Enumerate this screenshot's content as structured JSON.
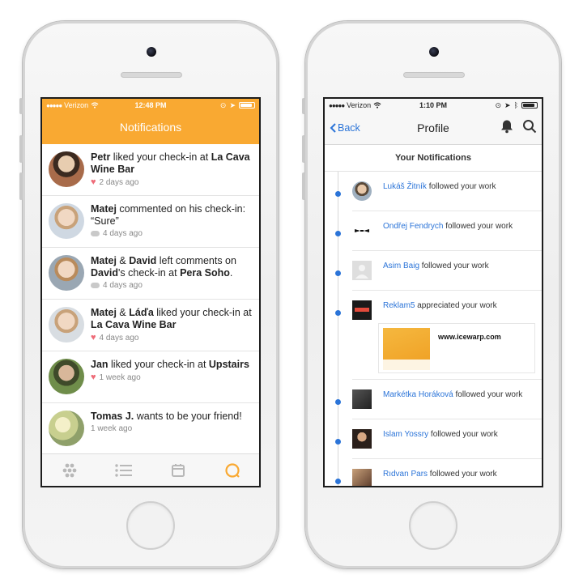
{
  "left_phone": {
    "status": {
      "carrier": "Verizon",
      "time": "12:48 PM"
    },
    "title": "Notifications",
    "items": [
      {
        "parts": [
          {
            "t": "Petr",
            "b": true
          },
          {
            "t": " liked your check-in at ",
            "b": false
          },
          {
            "t": "La Cava Wine Bar",
            "b": true
          }
        ],
        "meta_icon": "heart-icon",
        "time": "2 days ago"
      },
      {
        "parts": [
          {
            "t": "Matej",
            "b": true
          },
          {
            "t": " commented on his check-in: “Sure”",
            "b": false
          }
        ],
        "meta_icon": "comment-icon",
        "time": "4 days ago"
      },
      {
        "parts": [
          {
            "t": "Matej",
            "b": true
          },
          {
            "t": " & ",
            "b": false
          },
          {
            "t": "David",
            "b": true
          },
          {
            "t": " left comments on ",
            "b": false
          },
          {
            "t": "David",
            "b": true
          },
          {
            "t": "'s check-in at ",
            "b": false
          },
          {
            "t": "Pera Soho",
            "b": true
          },
          {
            "t": ".",
            "b": false
          }
        ],
        "meta_icon": "comment-icon",
        "time": "4 days ago"
      },
      {
        "parts": [
          {
            "t": "Matej",
            "b": true
          },
          {
            "t": " & ",
            "b": false
          },
          {
            "t": "Láďa",
            "b": true
          },
          {
            "t": " liked your check-in at ",
            "b": false
          },
          {
            "t": "La Cava Wine Bar",
            "b": true
          }
        ],
        "meta_icon": "heart-icon",
        "time": "4 days ago"
      },
      {
        "parts": [
          {
            "t": "Jan",
            "b": true
          },
          {
            "t": " liked your check-in at ",
            "b": false
          },
          {
            "t": "Upstairs",
            "b": true
          }
        ],
        "meta_icon": "heart-icon",
        "time": "1 week ago"
      },
      {
        "parts": [
          {
            "t": "Tomas J.",
            "b": true
          },
          {
            "t": " wants to be your friend!",
            "b": false
          }
        ],
        "meta_icon": "",
        "time": "1 week ago"
      }
    ],
    "tabs": [
      "dots-grid-icon",
      "list-icon",
      "calendar-icon",
      "chat-icon"
    ],
    "accent": "#f9a932"
  },
  "right_phone": {
    "status": {
      "carrier": "Verizon",
      "time": "1:10 PM"
    },
    "back_label": "Back",
    "title": "Profile",
    "section_title": "Your Notifications",
    "items": [
      {
        "who": "Lukáš Žitník",
        "action": " followed your work"
      },
      {
        "who": "Ondřej Fendrych",
        "action": " followed your work"
      },
      {
        "who": "Asim Baig",
        "action": " followed your work"
      },
      {
        "who": "Reklam5",
        "action": " appreciated your work",
        "card_url": "www.icewarp.com"
      },
      {
        "who": "Markétka Horáková",
        "action": " followed your work"
      },
      {
        "who": "Islam Yossry",
        "action": " followed your work"
      },
      {
        "who": "Rıdvan Pars",
        "action": " followed your work"
      }
    ],
    "link_color": "#2b74d8"
  }
}
